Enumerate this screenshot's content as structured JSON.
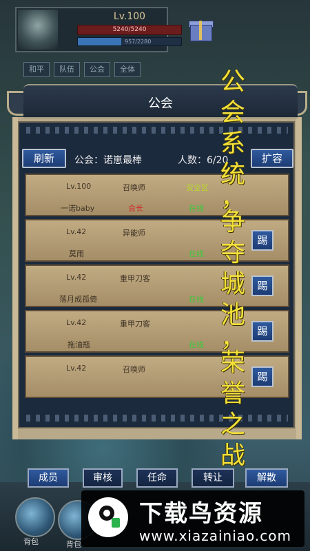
{
  "hud": {
    "level": "Lv.100",
    "hp_text": "5240/5240",
    "mp_text": "957/2280",
    "tabs": [
      "和平",
      "队伍",
      "公会",
      "全体"
    ]
  },
  "panel": {
    "title": "公会",
    "refresh_label": "刷新",
    "guild_label": "公会：",
    "guild_name": "诺崽最棒",
    "member_count_label": "人数：",
    "member_count": "6/20",
    "expand_label": "扩容"
  },
  "members": [
    {
      "level": "Lv.100",
      "class": "召唤师",
      "name": "一诺baby",
      "zone": "安全区",
      "role": "会长",
      "status": "在线",
      "kick": ""
    },
    {
      "level": "Lv.42",
      "class": "异能师",
      "name": "莫雨",
      "zone": "",
      "role": "",
      "status": "在线",
      "kick": "踢"
    },
    {
      "level": "Lv.42",
      "class": "重甲刀客",
      "name": "落月成孤倚",
      "zone": "",
      "role": "",
      "status": "在线",
      "kick": "踢"
    },
    {
      "level": "Lv.42",
      "class": "重甲刀客",
      "name": "拖油瓶",
      "zone": "",
      "role": "",
      "status": "在线",
      "kick": "踢"
    },
    {
      "level": "Lv.42",
      "class": "召唤师",
      "name": "",
      "zone": "",
      "role": "",
      "status": "",
      "kick": "踢"
    }
  ],
  "bottom_buttons": {
    "members": "成员",
    "review": "审核",
    "appoint": "任命",
    "transfer": "转让",
    "disband": "解散"
  },
  "calligraphy": [
    "公",
    "会",
    "系",
    "统",
    "，",
    "争",
    "夺",
    "城",
    "池",
    "，",
    "荣",
    "誉",
    "之",
    "战"
  ],
  "bottom_hud": {
    "skill_label_1": "背包",
    "skill_label_2": "背包"
  },
  "watermark": {
    "title": "下载鸟资源",
    "url": "www.xiazainiao.com"
  },
  "colors": {
    "button_blue": "#1d3c74",
    "row_tan": "#b49d75",
    "online_green": "#3cc83c",
    "leader_red": "#d22a2a",
    "safe_zone_yellow": "#b8d82a",
    "calligraphy_yellow": "#f3e03a"
  }
}
